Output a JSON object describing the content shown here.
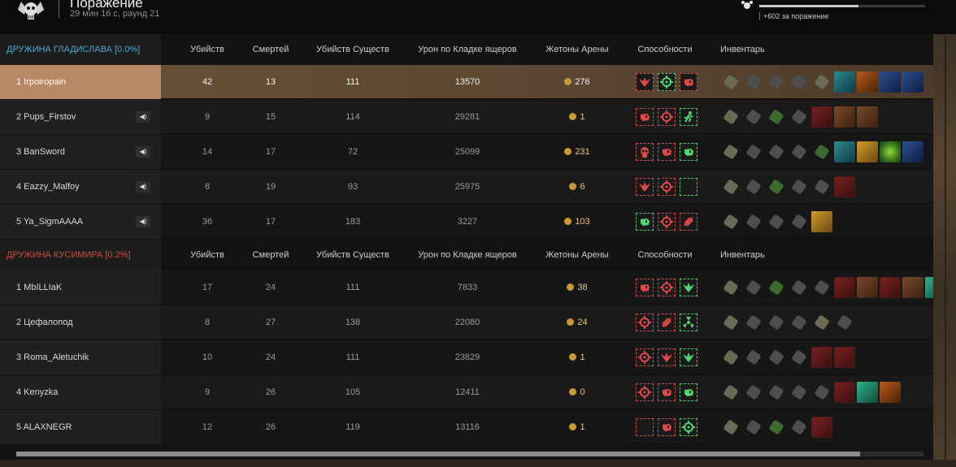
{
  "header": {
    "result_title": "Поражение",
    "result_sub": "29 мин 16 с, раунд 21",
    "xp_text": "+602 за поражение",
    "xp_progress": 0.6
  },
  "columns": [
    "Убийств",
    "Смертей",
    "Убийств Существ",
    "Урон по Кладке ящеров",
    "Жетоны Арены",
    "Способности",
    "Инвентарь"
  ],
  "teams": [
    {
      "name": "ДРУЖИНА ГЛАДИСЛАВА [0.0%]",
      "color": "#4fa6d4",
      "players": [
        {
          "name": "1 Irpoiropain",
          "kills": "42",
          "deaths": "13",
          "creature_kills": "111",
          "damage": "13570",
          "tokens": "276",
          "muted": false,
          "highlight": true,
          "abilities": [
            {
              "c": "red",
              "i": "bird"
            },
            {
              "c": "green",
              "i": "target"
            },
            {
              "c": "red",
              "i": "fist"
            }
          ],
          "inventory": [
            "gear",
            "plain",
            "plain",
            "plain",
            "gear",
            "cyan",
            "orange",
            "blue",
            "blue"
          ]
        },
        {
          "name": "2 Pups_Firstov",
          "kills": "9",
          "deaths": "15",
          "creature_kills": "114",
          "damage": "29281",
          "tokens": "1",
          "muted": true,
          "abilities": [
            {
              "c": "red",
              "i": "fist"
            },
            {
              "c": "red",
              "i": "target"
            },
            {
              "c": "green",
              "i": "run"
            }
          ],
          "inventory": [
            "gear",
            "plain",
            "green-item",
            "plain",
            "red",
            "brown",
            "brown"
          ]
        },
        {
          "name": "3 BanSword",
          "kills": "14",
          "deaths": "17",
          "creature_kills": "72",
          "damage": "25099",
          "tokens": "231",
          "muted": true,
          "abilities": [
            {
              "c": "red",
              "i": "skull"
            },
            {
              "c": "red",
              "i": "fist"
            },
            {
              "c": "green",
              "i": "fist"
            }
          ],
          "inventory": [
            "gear",
            "plain",
            "plain",
            "plain",
            "green-item",
            "cyan",
            "gold",
            "greenglow",
            "blue"
          ]
        },
        {
          "name": "4 Eazzy_Malfoy",
          "kills": "8",
          "deaths": "19",
          "creature_kills": "93",
          "damage": "25975",
          "tokens": "6",
          "muted": true,
          "abilities": [
            {
              "c": "red",
              "i": "bird"
            },
            {
              "c": "red",
              "i": "target"
            },
            {
              "c": "green",
              "i": "drop"
            }
          ],
          "inventory": [
            "gear",
            "plain",
            "green-item",
            "plain",
            "plain",
            "red"
          ]
        },
        {
          "name": "5 Ya_SigmAAAA",
          "kills": "36",
          "deaths": "17",
          "creature_kills": "183",
          "damage": "3227",
          "tokens": "103",
          "muted": true,
          "abilities": [
            {
              "c": "green",
              "i": "fist"
            },
            {
              "c": "red",
              "i": "target"
            },
            {
              "c": "red",
              "i": "slash"
            }
          ],
          "inventory": [
            "gear",
            "plain",
            "plain",
            "plain",
            "gold"
          ]
        }
      ]
    },
    {
      "name": "ДРУЖИНА КУСИМИРА [0.2%]",
      "color": "#d14b44",
      "players": [
        {
          "name": "1 MbILLIaK",
          "kills": "17",
          "deaths": "24",
          "creature_kills": "111",
          "damage": "7833",
          "tokens": "38",
          "muted": false,
          "abilities": [
            {
              "c": "red",
              "i": "fist"
            },
            {
              "c": "red",
              "i": "target"
            },
            {
              "c": "green",
              "i": "bird"
            }
          ],
          "inventory": [
            "gear",
            "plain",
            "green-item",
            "plain",
            "plain",
            "red",
            "brown",
            "red",
            "brown",
            "teal"
          ]
        },
        {
          "name": "2 Цефалопод",
          "kills": "8",
          "deaths": "27",
          "creature_kills": "138",
          "damage": "22080",
          "tokens": "24",
          "muted": false,
          "abilities": [
            {
              "c": "red",
              "i": "target"
            },
            {
              "c": "red",
              "i": "slash"
            },
            {
              "c": "green",
              "i": "radiation"
            }
          ],
          "inventory": [
            "gear",
            "plain",
            "plain",
            "plain",
            "gear",
            "plain"
          ]
        },
        {
          "name": "3 Roma_Aletuchik",
          "kills": "10",
          "deaths": "24",
          "creature_kills": "111",
          "damage": "23829",
          "tokens": "1",
          "muted": false,
          "abilities": [
            {
              "c": "red",
              "i": "target"
            },
            {
              "c": "red",
              "i": "bird"
            },
            {
              "c": "green",
              "i": "bird"
            }
          ],
          "inventory": [
            "gear",
            "plain",
            "plain",
            "plain",
            "red",
            "red"
          ]
        },
        {
          "name": "4 Kenyzka",
          "kills": "9",
          "deaths": "26",
          "creature_kills": "105",
          "damage": "12411",
          "tokens": "0",
          "muted": false,
          "abilities": [
            {
              "c": "red",
              "i": "target"
            },
            {
              "c": "red",
              "i": "fist"
            },
            {
              "c": "green",
              "i": "fist"
            }
          ],
          "inventory": [
            "gear",
            "plain",
            "plain",
            "plain",
            "plain",
            "red",
            "teal",
            "orange"
          ]
        },
        {
          "name": "5 ALAXNEGR",
          "kills": "12",
          "deaths": "26",
          "creature_kills": "119",
          "damage": "13116",
          "tokens": "1",
          "muted": false,
          "abilities": [
            {
              "c": "red",
              "i": "drop"
            },
            {
              "c": "red",
              "i": "fist"
            },
            {
              "c": "green",
              "i": "target"
            }
          ],
          "inventory": [
            "gear",
            "plain",
            "green-item",
            "plain",
            "red"
          ]
        }
      ]
    }
  ],
  "scrollbar": {
    "position": 0.0,
    "thumb_fraction": 0.93
  }
}
